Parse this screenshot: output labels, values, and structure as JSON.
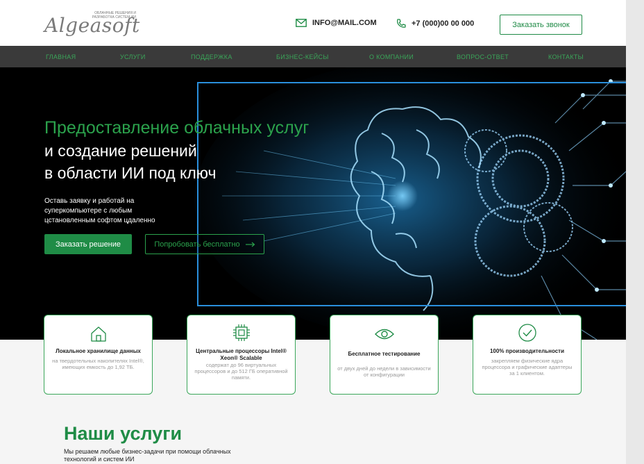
{
  "header": {
    "logo_word": "Algeasoft",
    "logo_tagline": "облачные решения и разработка систем ИИ",
    "email": "INFO@MAIL.COM",
    "phone": "+7 (000)00 00 000",
    "callback_label": "Заказать звонок"
  },
  "nav": {
    "items": [
      "ГЛАВНАЯ",
      "УСЛУГИ",
      "ПОДДЕРЖКА",
      "БИЗНЕС-КЕЙСЫ",
      "О КОМПАНИИ",
      "ВОПРОС-ОТВЕТ",
      "КОНТАКТЫ"
    ]
  },
  "hero": {
    "title_line1": "Предоставление облачных услуг",
    "title_line2": "и создание решений",
    "title_line3": "в области ИИ под ключ",
    "text": "Оставь заявку и работай на суперкомпьютере с любым цстановленным софтом цдаленно",
    "order_label": "Заказать решение",
    "try_label": "Попробовать бесплатно"
  },
  "cards": [
    {
      "icon": "house-icon",
      "title": "Локальное хранилище данных",
      "text": "на твердотельных накопителях Intel®, имеющих емкость до 1,92 ТБ."
    },
    {
      "icon": "cpu-icon",
      "title": "Центральные процессоры Intel® Xeon® Scalable",
      "text": "содержат до 96 виртуальных процессоров и до 512 ГБ оперативной памяти."
    },
    {
      "icon": "eye-icon",
      "title": "Бесплатное тестирование",
      "text": "от двух дней до недели в зависимости от конфигурации"
    },
    {
      "icon": "check-circle-icon",
      "title": "100% производительности",
      "text": "закрепляем физические ядра процессора и графические адаптеры за 1 клиентом."
    }
  ],
  "services": {
    "title": "Наши услуги",
    "subtitle": "Мы решаем любые бизнес-задачи при помощи облачных технологий и систем ИИ"
  },
  "colors": {
    "accent": "#1f8c46",
    "nav_bg": "#3a3a3a",
    "frame": "#2a8fdc"
  }
}
